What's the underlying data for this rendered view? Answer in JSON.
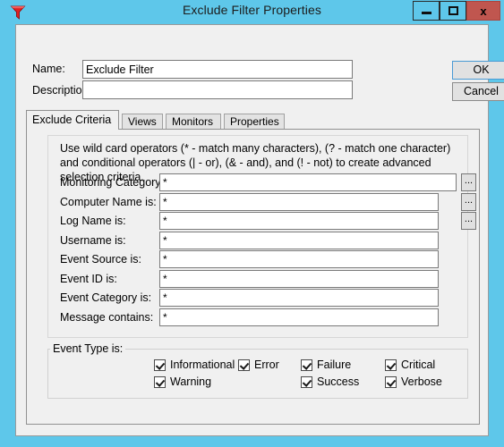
{
  "window": {
    "title": "Exclude Filter Properties",
    "icon": "funnel-filter-icon",
    "icon_color": "#e02020",
    "titlebar_color": "#5ec7ea",
    "close_color": "#c0564f",
    "controls": {
      "minimize": "–",
      "maximize": "□",
      "close": "x"
    }
  },
  "header": {
    "name_label": "Name:",
    "name_value": "Exclude Filter",
    "description_label": "Description",
    "description_value": "",
    "ok_label": "OK",
    "cancel_label": "Cancel"
  },
  "tabs": [
    {
      "label": "Exclude Criteria",
      "active": true
    },
    {
      "label": "Views",
      "active": false
    },
    {
      "label": "Monitors",
      "active": false
    },
    {
      "label": "Properties",
      "active": false
    }
  ],
  "criteria": {
    "hint": "Use wild card operators (* - match many characters), (? - match one character) and conditional operators (| - or), (& - and), and (! - not) to create advanced selection criteria.",
    "browse_label": "...",
    "fields": [
      {
        "label": "Monitoring Category is:",
        "value": "*",
        "has_browse": true
      },
      {
        "label": "Computer Name is:",
        "value": "*",
        "has_browse": true
      },
      {
        "label": "Log Name is:",
        "value": "*",
        "has_browse": true
      },
      {
        "label": "Username is:",
        "value": "*",
        "has_browse": false
      },
      {
        "label": "Event Source is:",
        "value": "*",
        "has_browse": false
      },
      {
        "label": "Event ID is:",
        "value": "*",
        "has_browse": false
      },
      {
        "label": "Event Category is:",
        "value": "*",
        "has_browse": false
      },
      {
        "label": "Message contains:",
        "value": "*",
        "has_browse": false
      }
    ]
  },
  "event_type": {
    "legend": "Event Type is:",
    "checkboxes": [
      {
        "label": "Informational",
        "checked": true,
        "col": 0,
        "row": 0
      },
      {
        "label": "Error",
        "checked": true,
        "col": 1,
        "row": 0
      },
      {
        "label": "Failure",
        "checked": true,
        "col": 2,
        "row": 0
      },
      {
        "label": "Critical",
        "checked": true,
        "col": 3,
        "row": 0
      },
      {
        "label": "Warning",
        "checked": true,
        "col": 0,
        "row": 1
      },
      {
        "label": "Success",
        "checked": true,
        "col": 2,
        "row": 1
      },
      {
        "label": "Verbose",
        "checked": true,
        "col": 3,
        "row": 1
      }
    ]
  }
}
